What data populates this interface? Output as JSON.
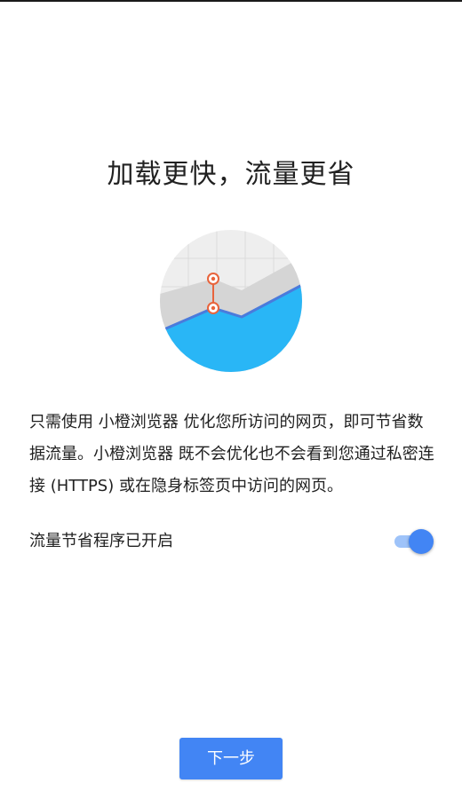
{
  "page": {
    "title": "加载更快，流量更省",
    "illustration_icon": "data-savings-chart-icon",
    "description": "只需使用 小橙浏览器 优化您所访问的网页，即可节省数据流量。小橙浏览器 既不会优化也不会看到您通过私密连接 (HTTPS) 或在隐身标签页中访问的网页。",
    "toggle": {
      "label": "流量节省程序已开启",
      "state": "on"
    },
    "next_button": "下一步"
  },
  "colors": {
    "accent": "#4285f4",
    "chart_fill": "#29b6f6",
    "chart_line": "#4a7bdc",
    "marker": "#e8643c"
  }
}
